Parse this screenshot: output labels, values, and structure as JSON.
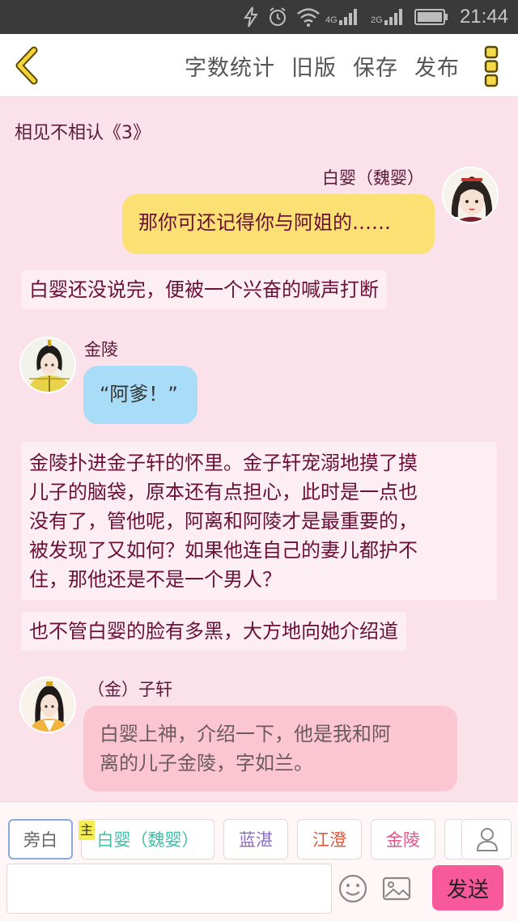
{
  "status_bar": {
    "time": "21:44",
    "network_1": "4G",
    "network_2": "2G"
  },
  "toolbar": {
    "buttons": [
      "字数统计",
      "旧版",
      "保存",
      "发布"
    ]
  },
  "chapter": {
    "title": "相见不相认《3》"
  },
  "messages": [
    {
      "type": "dialogue",
      "speaker": "白婴（魏婴）",
      "text": "那你可还记得你与阿姐的……",
      "bubble_color": "#fbe074"
    },
    {
      "type": "narration",
      "text": "白婴还没说完，便被一个兴奋的喊声打断"
    },
    {
      "type": "dialogue",
      "speaker": "金陵",
      "text": "“阿爹！”",
      "bubble_color": "#a9dcf7"
    },
    {
      "type": "narration",
      "lines": [
        "金陵扑进金子轩的怀里。金子轩宠溺地摸了摸",
        "儿子的脑袋，原本还有点担心，此时是一点也",
        "没有了，管他呢，阿离和阿陵才是最重要的，",
        "被发现了又如何？如果他连自己的妻儿都护不",
        "住，那他还是不是一个男人？"
      ]
    },
    {
      "type": "narration",
      "text": "也不管白婴的脸有多黑，大方地向她介绍道"
    },
    {
      "type": "dialogue",
      "speaker": "（金）子轩",
      "lines": [
        "白婴上神，介绍一下，他是我和阿",
        "离的儿子金陵，字如兰。"
      ],
      "bubble_color": "#fcc5d2"
    }
  ],
  "composer": {
    "main_tag": "主",
    "roles": [
      {
        "label": "旁白",
        "color": "#666666"
      },
      {
        "label": "白婴（魏婴）",
        "color": "#3fbfa7"
      },
      {
        "label": "蓝湛",
        "color": "#8a6dc9"
      },
      {
        "label": "江澄",
        "color": "#e2563c"
      },
      {
        "label": "金陵",
        "color": "#e0558a"
      }
    ],
    "input_value": "",
    "send_label": "发送"
  },
  "colors": {
    "background": "#fbe1e9",
    "accent": "#f7599a",
    "text_primary": "#6a1035"
  }
}
